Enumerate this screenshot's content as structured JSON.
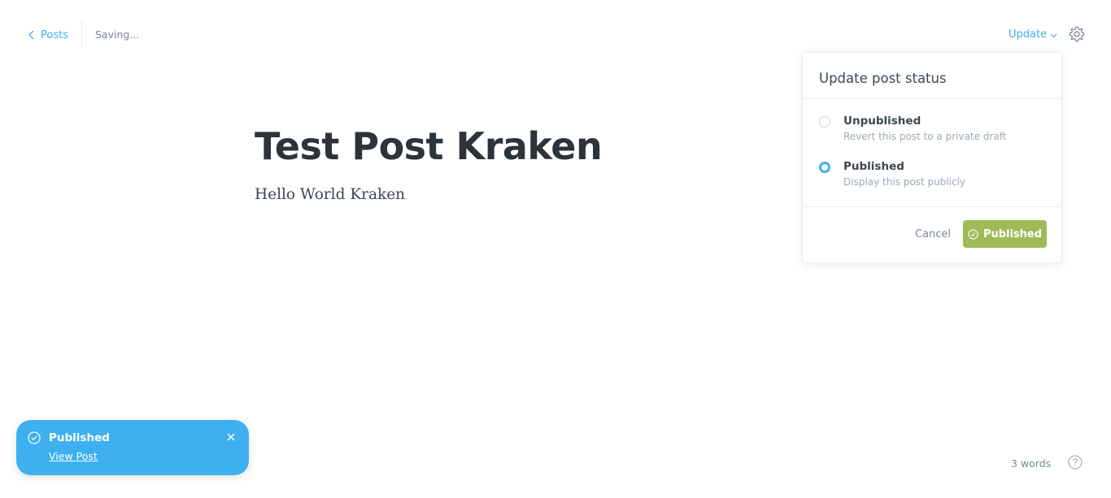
{
  "header": {
    "back_label": "Posts",
    "save_status": "Saving...",
    "update_label": "Update"
  },
  "editor": {
    "title": "Test Post Kraken",
    "body": "Hello World Kraken"
  },
  "publish_menu": {
    "title": "Update post status",
    "options": [
      {
        "label": "Unpublished",
        "description": "Revert this post to a private draft",
        "selected": false
      },
      {
        "label": "Published",
        "description": "Display this post publicly",
        "selected": true
      }
    ],
    "cancel_label": "Cancel",
    "confirm_label": "Published"
  },
  "notification": {
    "title": "Published",
    "link_label": "View Post"
  },
  "footer": {
    "word_count": "3 words"
  },
  "colors": {
    "accent": "#3eb0ef",
    "publish_green": "#9fbb58"
  },
  "icons": [
    "chevron-left-icon",
    "chevron-down-icon",
    "gear-icon",
    "check-circle-icon",
    "close-icon",
    "question-circle-icon"
  ]
}
